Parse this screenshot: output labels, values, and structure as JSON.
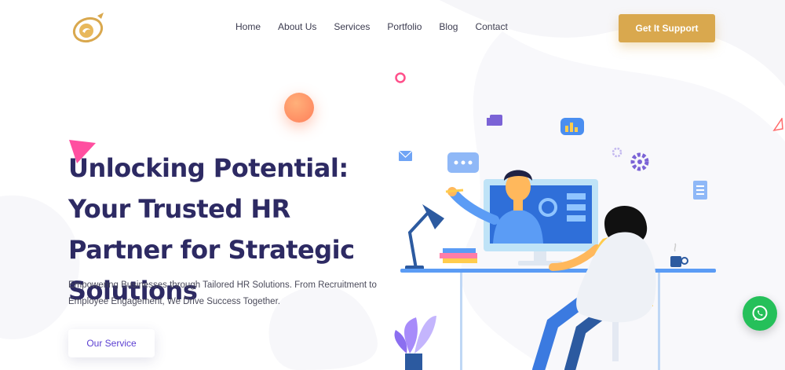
{
  "nav": {
    "items": [
      "Home",
      "About Us",
      "Services",
      "Portfolio",
      "Blog",
      "Contact"
    ]
  },
  "header": {
    "cta_label": "Get It Support"
  },
  "hero": {
    "title": "Unlocking Potential: Your Trusted HR Partner for Strategic Solutions",
    "subtitle": "Empowering Businesses through Tailored HR Solutions. From Recruitment to Employee Engagement, We Drive Success Together.",
    "button_label": "Our Service"
  },
  "colors": {
    "accent": "#d9a84e",
    "title": "#2d2a63",
    "button_text": "#5b3fd1",
    "whatsapp": "#25c05a"
  },
  "icons": [
    "logo",
    "whatsapp-icon",
    "thumbs-up-icon",
    "chart-icon",
    "mail-icon",
    "chat-icon",
    "gear-icon",
    "document-icon"
  ]
}
